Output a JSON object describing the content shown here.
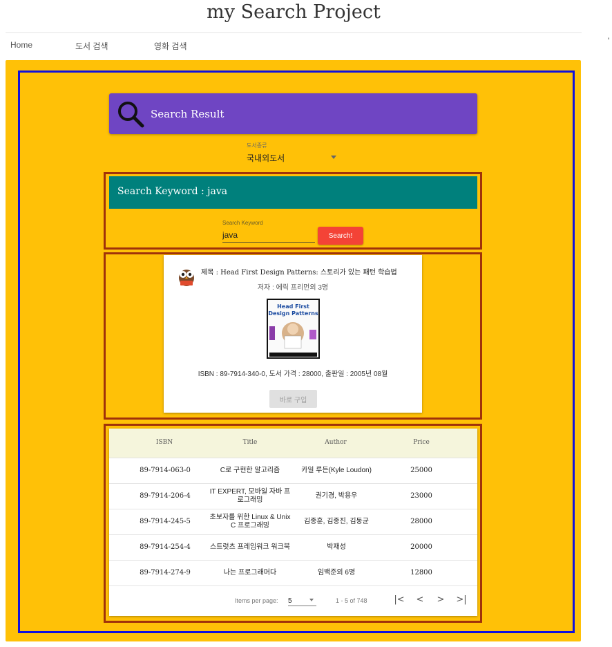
{
  "app": {
    "title": "my Search Project",
    "stray_char": "'"
  },
  "nav": {
    "items": [
      "Home",
      "도서 검색",
      "영화 검색"
    ]
  },
  "search_result": {
    "label": "Search Result"
  },
  "category": {
    "label": "도서종류",
    "value": "국내외도서"
  },
  "keyword_panel": {
    "banner": "Search Keyword : java",
    "field_label": "Search Keyword",
    "field_value": "java",
    "button_label": "Search!"
  },
  "book_card": {
    "title": "제목 : Head First Design Patterns: 스토리가 있는 패턴 학습법",
    "author": "저자 : 에릭 프리먼외 3명",
    "cover_title_line1": "Head First",
    "cover_title_line2": "Design Patterns",
    "details": "ISBN : 89-7914-340-0, 도서 가격 : 28000, 출판일 : 2005년 08월",
    "buy_button": "바로 구입"
  },
  "table": {
    "headers": [
      "ISBN",
      "Title",
      "Author",
      "Price"
    ],
    "rows": [
      [
        "89-7914-063-0",
        "C로 구현한 알고리즘",
        "카일 루든(Kyle Loudon)",
        "25000"
      ],
      [
        "89-7914-206-4",
        "IT EXPERT, 모바일 자바 프로그래밍",
        "권기경, 박용우",
        "23000"
      ],
      [
        "89-7914-245-5",
        "초보자를 위한 Linux & Unix C 프로그래밍",
        "김종훈, 김종진, 김동균",
        "28000"
      ],
      [
        "89-7914-254-4",
        "스트럿츠 프레임워크 워크북",
        "박재성",
        "20000"
      ],
      [
        "89-7914-274-9",
        "나는 프로그래머다",
        "임백준외 6명",
        "12800"
      ]
    ]
  },
  "paginator": {
    "items_per_page_label": "Items per page:",
    "page_size": "5",
    "range": "1 - 5 of 748",
    "first": "|<",
    "prev": "<",
    "next": ">",
    "last": ">|"
  },
  "colors": {
    "background": "#ffc107",
    "border_blue": "#1010dd",
    "border_red": "#a0320a",
    "result_banner": "#6f45c3",
    "keyword_banner": "#00807c",
    "search_button": "#f44336",
    "table_header": "#f5f5dc"
  },
  "icons": {
    "search_result": "magnifier-icon",
    "book": "owl-icon"
  }
}
